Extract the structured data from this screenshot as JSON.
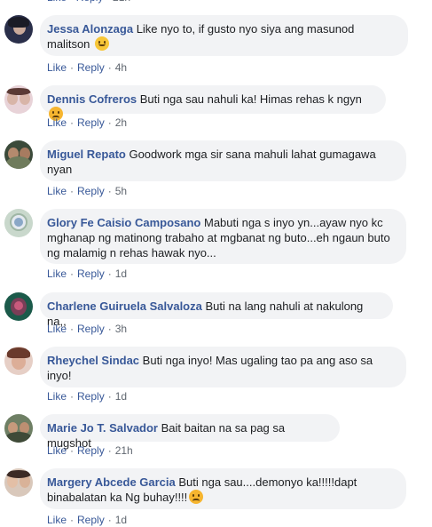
{
  "action_labels": {
    "like": "Like",
    "reply": "Reply"
  },
  "top_cutoff": {
    "time": "21h"
  },
  "comments": [
    {
      "author": "Jessa Alonzaga",
      "text": "Like nyo to, if gusto nyo siya ang masunod malitson",
      "emoji": "smiling-face",
      "time": "4h"
    },
    {
      "author": "Dennis Cofreros",
      "text": "Buti nga sau nahuli ka! Himas rehas k ngyn",
      "emoji": "angry-face",
      "time": "2h"
    },
    {
      "author": "Miguel Repato",
      "text": "Goodwork mga sir sana mahuli lahat gumagawa nyan",
      "emoji": "",
      "time": "5h"
    },
    {
      "author": "Glory Fe Caisio Camposano",
      "text": "Mabuti nga s inyo yn...ayaw nyo kc mghanap ng matinong trabaho at mgbanat ng buto...eh ngaun buto ng malamig n rehas hawak nyo...",
      "emoji": "",
      "time": "1d"
    },
    {
      "author": "Charlene Guiruela Salvaloza",
      "text": "Buti na lang nahuli at nakulong na,,",
      "emoji": "",
      "time": "3h"
    },
    {
      "author": "Rheychel Sindac",
      "text": "Buti nga inyo! Mas ugaling tao pa ang aso sa inyo!",
      "emoji": "",
      "time": "1d"
    },
    {
      "author": "Marie Jo T. Salvador",
      "text": "Bait baitan na sa pag sa mugshot",
      "emoji": "",
      "time": "21h"
    },
    {
      "author": "Margery Abcede Garcia",
      "text": "Buti nga sau....demonyo ka!!!!!dapt binabalatan ka Ng buhay!!!!",
      "emoji": "angry-face",
      "time": "1d"
    }
  ]
}
